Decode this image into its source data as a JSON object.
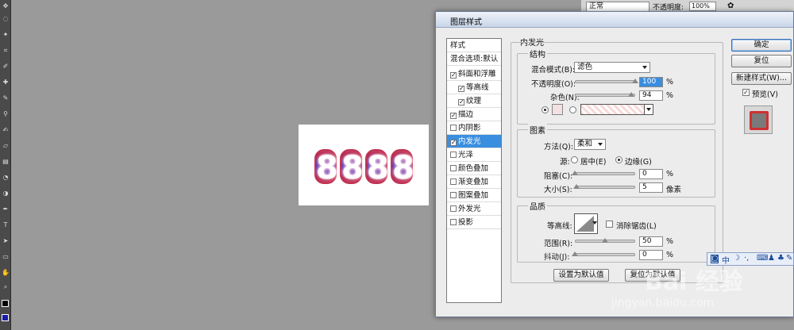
{
  "top_bar": {
    "blend_mode": "正常",
    "opacity_label": "不透明度:",
    "opacity_value": "100%"
  },
  "canvas": {
    "digits": [
      "8",
      "8",
      "8",
      "8"
    ]
  },
  "dialog": {
    "title": "图层样式",
    "styles_header": "样式",
    "blend_options": "混合选项:默认",
    "style_items": [
      {
        "label": "斜面和浮雕",
        "checked": true,
        "sub": false
      },
      {
        "label": "等高线",
        "checked": true,
        "sub": true
      },
      {
        "label": "纹理",
        "checked": true,
        "sub": true
      },
      {
        "label": "描边",
        "checked": true,
        "sub": false
      },
      {
        "label": "内阴影",
        "checked": false,
        "sub": false
      },
      {
        "label": "内发光",
        "checked": true,
        "sub": false,
        "selected": true
      },
      {
        "label": "光泽",
        "checked": false,
        "sub": false
      },
      {
        "label": "颜色叠加",
        "checked": false,
        "sub": false
      },
      {
        "label": "渐变叠加",
        "checked": false,
        "sub": false
      },
      {
        "label": "图案叠加",
        "checked": false,
        "sub": false
      },
      {
        "label": "外发光",
        "checked": false,
        "sub": false
      },
      {
        "label": "投影",
        "checked": false,
        "sub": false
      }
    ],
    "panel_title": "内发光",
    "structure": {
      "title": "结构",
      "blend_mode_label": "混合模式(B):",
      "blend_mode_value": "滤色",
      "opacity_label": "不透明度(O):",
      "opacity_value": "100",
      "noise_label": "杂色(N):",
      "noise_value": "94",
      "percent": "%",
      "opacity_level": 100,
      "noise_level": 94
    },
    "elements": {
      "title": "图素",
      "method_label": "方法(Q):",
      "method_value": "柔和",
      "source_label": "源:",
      "source_center": "居中(E)",
      "source_edge": "边缘(G)",
      "choke_label": "阻塞(C):",
      "choke_value": "0",
      "size_label": "大小(S):",
      "size_value": "5",
      "size_unit": "像素",
      "percent": "%",
      "choke_level": 0,
      "size_level": 2
    },
    "quality": {
      "title": "品质",
      "contour_label": "等高线:",
      "anti_alias_label": "消除锯齿(L)",
      "range_label": "范围(R):",
      "range_value": "50",
      "jitter_label": "抖动(J):",
      "jitter_value": "0",
      "percent": "%",
      "range_level": 50,
      "jitter_level": 0
    },
    "make_default": "设置为默认值",
    "reset_default": "复位为默认值",
    "buttons": {
      "ok": "确定",
      "cancel": "复位",
      "new_style": "新建样式(W)...",
      "preview": "预览(V)"
    }
  },
  "ime_bar": {
    "items": [
      "中",
      "☽",
      "·,",
      "⌨",
      "♟",
      "♣",
      "✎"
    ]
  },
  "watermark": {
    "brand": "Bai 经验",
    "url": "jingyan.baidu.com"
  }
}
